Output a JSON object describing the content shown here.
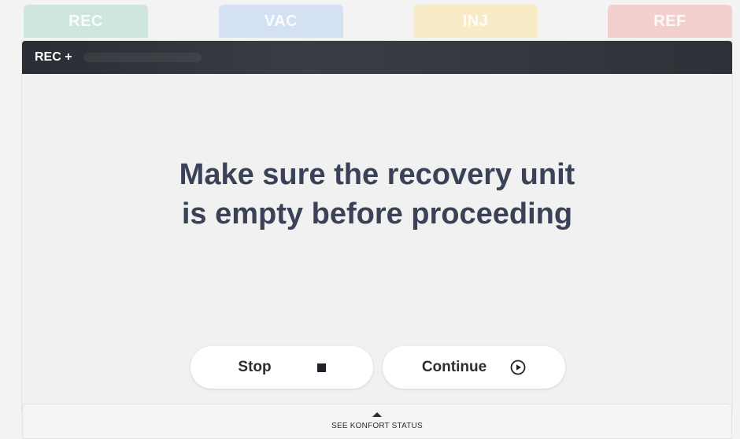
{
  "tabs": [
    {
      "label": "REC",
      "color": "#cfe6dc"
    },
    {
      "label": "VAC",
      "color": "#d3e1f2"
    },
    {
      "label": "INJ",
      "color": "#f7ecc7"
    },
    {
      "label": "REF",
      "color": "#f3cfcd"
    }
  ],
  "panel": {
    "title": "REC +",
    "message_line1": "Make sure the recovery unit",
    "message_line2": "is empty before proceeding"
  },
  "buttons": {
    "stop_label": "Stop",
    "continue_label": "Continue",
    "stop_icon": "stop-icon",
    "continue_icon": "play-circle-icon"
  },
  "status_bar": {
    "label": "SEE KONFORT STATUS",
    "icon": "caret-up-icon"
  }
}
